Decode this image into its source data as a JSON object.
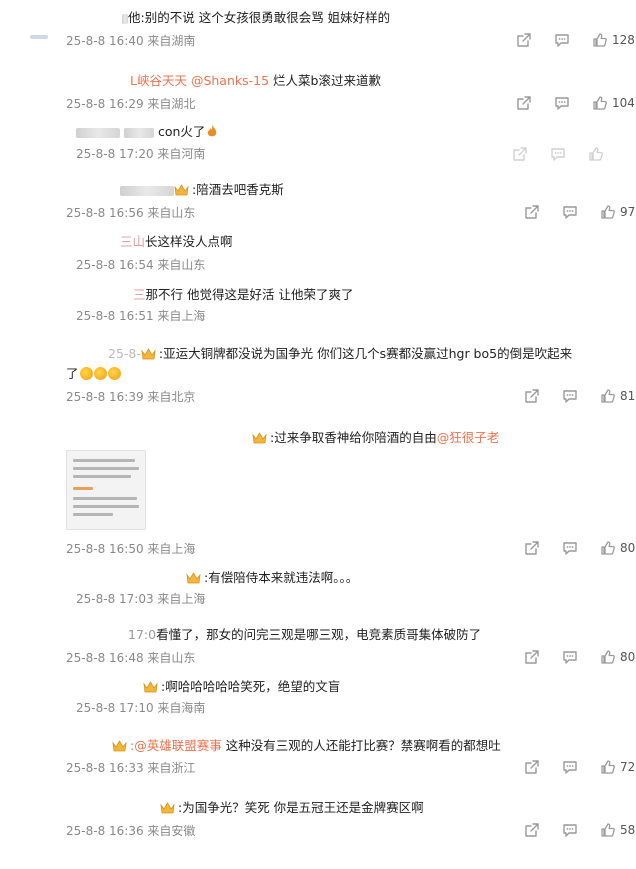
{
  "comments": [
    {
      "id": "c1",
      "text": "别的不说 这个女孩很勇敢很会骂 姐妹好样的",
      "prefix": "他",
      "meta": "25-8-8 16:40 来自湖南",
      "likes": "128"
    },
    {
      "id": "c2",
      "prefix_user": "L峡谷天天",
      "mention": "@Shanks-15",
      "text": " 烂人菜b滚过来道歉",
      "meta": "25-8-8 16:29 来自湖北",
      "likes": "104"
    },
    {
      "id": "c3",
      "text": "con火了",
      "meta": "25-8-8 17:20 来自河南",
      "likes": ""
    },
    {
      "id": "c4",
      "text": ":陪酒去吧香克斯",
      "meta": "25-8-8 16:56 来自山东",
      "likes": "97"
    },
    {
      "id": "c4r1",
      "prefix": "三山",
      "text": "长这样没人点啊",
      "meta": "25-8-8 16:54 来自山东"
    },
    {
      "id": "c4r2",
      "prefix": "三",
      "text": "那不行 他觉得这是好活 让他荣了爽了",
      "meta": "25-8-8 16:51 来自上海"
    },
    {
      "id": "c5",
      "prefix": "25-8-",
      "text": ":亚运大铜牌都没说为国争光 你们这几个s赛都没赢过hgr bo5的倒是吹起来",
      "text2": "了",
      "meta": "25-8-8 16:39 来自北京",
      "likes": "81"
    },
    {
      "id": "c6",
      "text": ":过来争取香神给你陪酒的自由",
      "mention": "@狂很子老",
      "meta": "25-8-8 16:50 来自上海",
      "likes": "80"
    },
    {
      "id": "c6r1",
      "text": ":有偿陪侍本来就违法啊。。。",
      "meta": "25-8-8 17:03 来自上海"
    },
    {
      "id": "c7",
      "prefix": "17:0",
      "text": "看懂了，那女的问完三观是哪三观，电竞素质哥集体破防了",
      "meta": "25-8-8 16:48 来自山东",
      "likes": "80"
    },
    {
      "id": "c7r1",
      "text": ":啊哈哈哈哈哈笑死，绝望的文盲",
      "meta": "25-8-8 17:10 来自海南"
    },
    {
      "id": "c8",
      "mention": ":@英雄联盟赛事",
      "text": " 这种没有三观的人还能打比赛？禁赛啊看的都想吐",
      "meta": "25-8-8 16:33 来自浙江",
      "likes": "72"
    },
    {
      "id": "c9",
      "text": ":为国争光？笑死 你是五冠王还是金牌赛区啊",
      "meta": "25-8-8 16:36 来自安徽",
      "likes": "58"
    }
  ],
  "colors": {
    "mention": "#eb7350",
    "meta": "#8a8a8a",
    "icon": "#9a9a9a"
  },
  "icons": {
    "share": "share-icon",
    "comment": "comment-icon",
    "like": "like-icon",
    "crown": "crown-badge-icon"
  }
}
